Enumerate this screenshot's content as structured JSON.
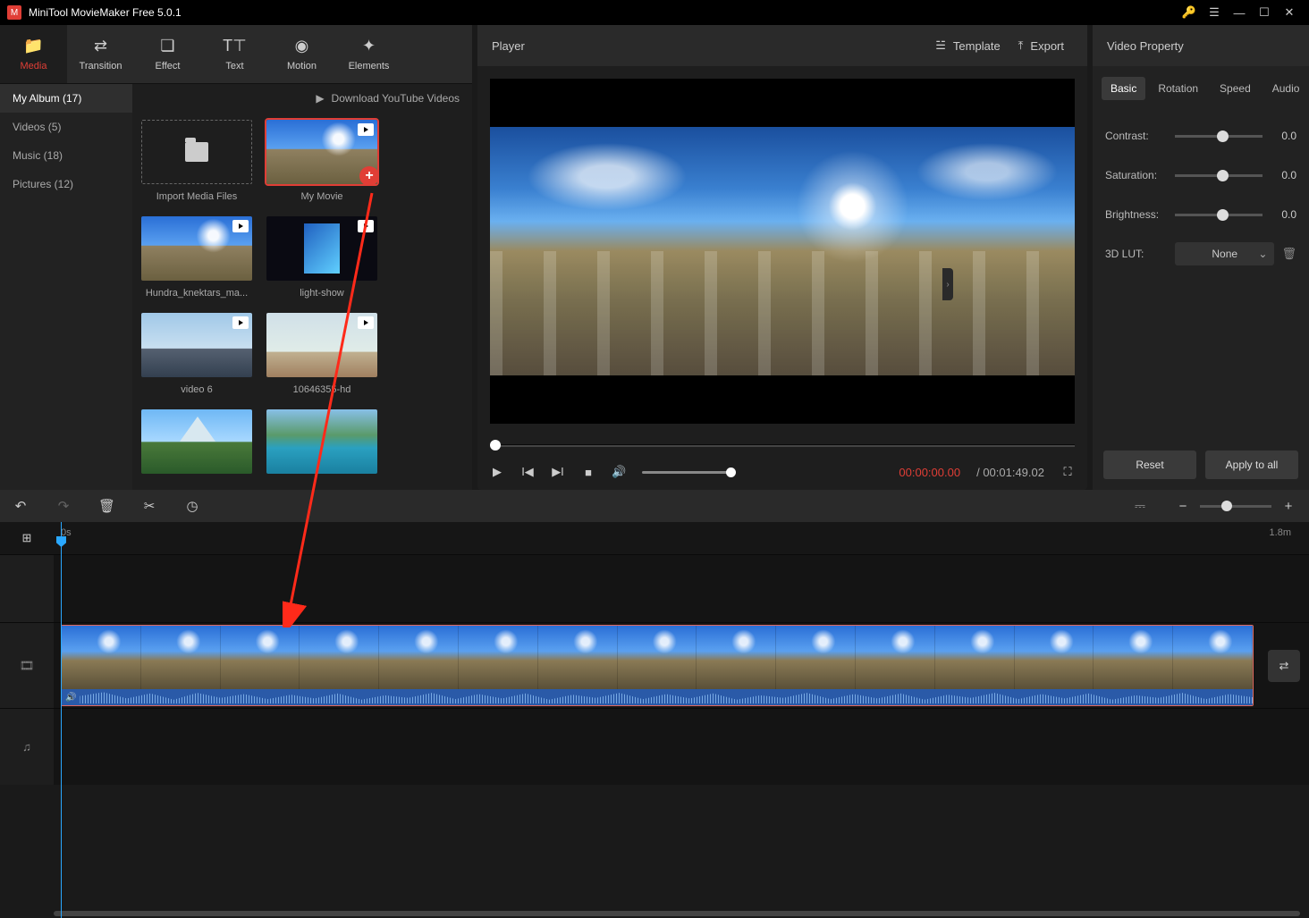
{
  "app": {
    "title": "MiniTool MovieMaker Free 5.0.1"
  },
  "toolTabs": [
    {
      "id": "media",
      "label": "Media"
    },
    {
      "id": "transition",
      "label": "Transition"
    },
    {
      "id": "effect",
      "label": "Effect"
    },
    {
      "id": "text",
      "label": "Text"
    },
    {
      "id": "motion",
      "label": "Motion"
    },
    {
      "id": "elements",
      "label": "Elements"
    }
  ],
  "sidebar": {
    "items": [
      {
        "label": "My Album (17)",
        "selected": true
      },
      {
        "label": "Videos (5)"
      },
      {
        "label": "Music (18)"
      },
      {
        "label": "Pictures (12)"
      }
    ],
    "download_label": "Download YouTube Videos"
  },
  "media": {
    "import_label": "Import Media Files",
    "items": [
      {
        "label": "My Movie",
        "kind": "video",
        "selected": true,
        "add": true,
        "thumb": "sky"
      },
      {
        "label": "Hundra_knektars_ma...",
        "kind": "video",
        "thumb": "sky"
      },
      {
        "label": "light-show",
        "kind": "video",
        "thumb": "dark"
      },
      {
        "label": "video 6",
        "kind": "video",
        "thumb": "city"
      },
      {
        "label": "10646355-hd",
        "kind": "video",
        "thumb": "people"
      },
      {
        "label": "",
        "kind": "image",
        "thumb": "mountain"
      },
      {
        "label": "",
        "kind": "image",
        "thumb": "lake"
      }
    ]
  },
  "player": {
    "title": "Player",
    "template_label": "Template",
    "export_label": "Export",
    "current_time": "00:00:00.00",
    "duration": "00:01:49.02",
    "duration_prefix": "/ "
  },
  "props": {
    "title": "Video Property",
    "tabs": [
      "Basic",
      "Rotation",
      "Speed",
      "Audio"
    ],
    "contrast": {
      "label": "Contrast:",
      "value": "0.0"
    },
    "saturation": {
      "label": "Saturation:",
      "value": "0.0"
    },
    "brightness": {
      "label": "Brightness:",
      "value": "0.0"
    },
    "lut": {
      "label": "3D LUT:",
      "value": "None"
    },
    "reset_label": "Reset",
    "apply_label": "Apply to all"
  },
  "timeline": {
    "start": "0s",
    "end": "1.8m"
  }
}
